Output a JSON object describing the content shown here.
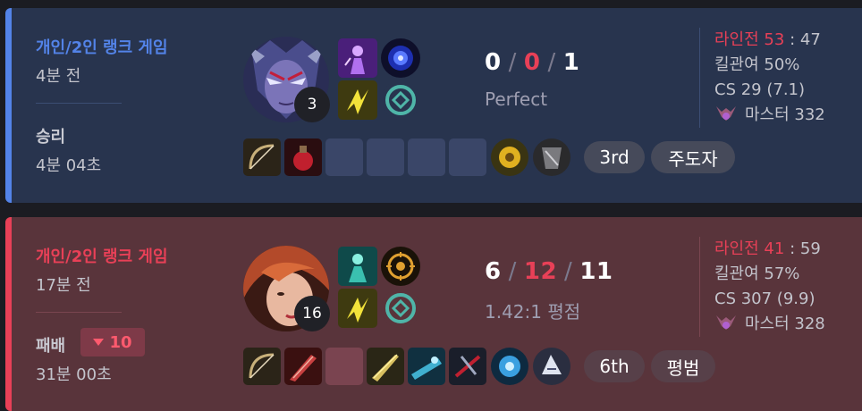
{
  "matches": [
    {
      "result_class": "win",
      "queue": "개인/2인 랭크 게임",
      "time_ago": "4분 전",
      "result": "승리",
      "duration": "4분 04초",
      "champion_level": "3",
      "kda": {
        "kills": "0",
        "deaths": "0",
        "assists": "1"
      },
      "kda_ratio": "Perfect",
      "place": "3rd",
      "tag": "주도자",
      "laning_label": "라인전",
      "laning_score": "53",
      "laning_sep": ":",
      "laning_opp": "47",
      "kill_participation": "킬관여 50%",
      "cs": "CS 29 (7.1)",
      "tier": "마스터 332"
    },
    {
      "result_class": "loss",
      "queue": "개인/2인 랭크 게임",
      "time_ago": "17분 전",
      "result": "패배",
      "lp_change": "10",
      "duration": "31분 00초",
      "champion_level": "16",
      "kda": {
        "kills": "6",
        "deaths": "12",
        "assists": "11"
      },
      "kda_ratio": "1.42:1 평점",
      "place": "6th",
      "tag": "평범",
      "laning_label": "라인전",
      "laning_score": "41",
      "laning_sep": ":",
      "laning_opp": "59",
      "kill_participation": "킬관여 57%",
      "cs": "CS 307 (9.9)",
      "tier": "마스터 328"
    }
  ],
  "colors": {
    "win_accent": "#5383e8",
    "loss_accent": "#e84057",
    "deaths": "#e84057"
  }
}
